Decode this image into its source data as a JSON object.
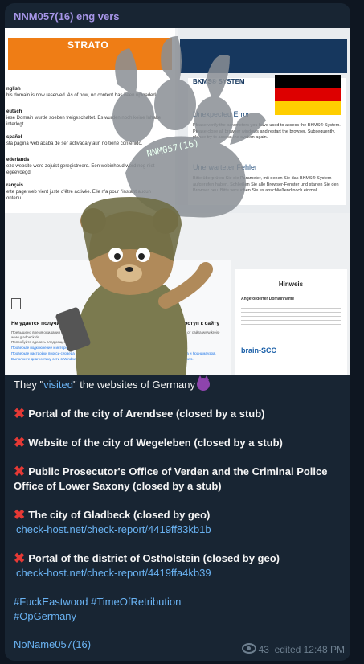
{
  "post": {
    "channel_name": "NNM057(16) eng vers",
    "media": {
      "strato": {
        "logo": "STRATO",
        "paragraphs": [
          {
            "lang": "nglish",
            "text": "his domain is now reserved. As of now, no content has been uploaded."
          },
          {
            "lang": "eutsch",
            "text": "iese Domain wurde soeben freigeschaltet. Es wurden noch keine Inhalte interlegt."
          },
          {
            "lang": "spañol",
            "text": "sta página web acaba de ser activada y aún no tiene contenido."
          },
          {
            "lang": "ederlands",
            "text": "eze website werd zojuist geregistreerd. Een webinhoud werd nog niet egeevoegd."
          },
          {
            "lang": "rançais",
            "text": "ette page web vient juste d'être activée. Elle n'a pour l'instant aucun ontenu."
          }
        ]
      },
      "bkms": {
        "logo": "BKMS® SYSTEM",
        "title_en": "Unexpected Error",
        "text_en": "Please verify the parameters you have used to access the BKMS® System. Please close all browser windows and restart the browser. Subsequently, please try to access the system again.",
        "title_de": "Unerwarteter Fehler",
        "text_de": "Bitte überprüfen Sie die Parameter, mit denen Sie das BKMS® System aufgerufen haben. Schließen Sie alle Browser-Fenster und starten Sie den Browser neu. Bitte versuchen Sie es anschließend noch einmal."
      },
      "watermark": "NNM057(16)",
      "lower_left": {
        "title": "Не удается получить доступ к сайту",
        "sub": "Превышено время ожидания ответа от сайта www.gladbeck.de.",
        "tips": [
          "Попробуйте сделать следующее:",
          "Проверьте подключение к интернету.",
          "Проверьте настройки прокси-сервера и брандмауэра.",
          "Выполните диагностику сети в Windows."
        ]
      },
      "lower_mid": {
        "title": "Не удается получить доступ к сайту",
        "sub": "Превышено время ожидания ответа от сайта www.kreis-oh.de.",
        "tips": [
          "Попробуйте сделать следующее:",
          "Проверьте подключение к интернету.",
          "Проверьте настройки прокси-сервера и брандмауэра.",
          "Выполните диагностику сети в Windows."
        ]
      },
      "hinweis": {
        "title": "Hinweis",
        "sub": "Angeforderter Domainname",
        "brand": "brain-SCC"
      }
    },
    "intro_prefix": "They \"",
    "intro_link": "visited",
    "intro_suffix": "\" the websites of Germany",
    "items": [
      {
        "text": "Portal of the city of Arendsee (closed by a stub)",
        "link": ""
      },
      {
        "text": "Website of the city of Wegeleben (closed by a stub)",
        "link": ""
      },
      {
        "text": "Public Prosecutor's Office of Verden and the Criminal Police Office of Lower Saxony (closed by a stub)",
        "link": ""
      },
      {
        "text": "The city of Gladbeck (closed by geo)",
        "link": "check-host.net/check-report/4419ff83kb1b"
      },
      {
        "text": "Portal of the district of Ostholstein (closed by geo)",
        "link": "check-host.net/check-report/4419ffa4kb39"
      }
    ],
    "hashtags_line1": "#FuckEastwood #TimeOfRetribution",
    "hashtags_line2": "#OpGermany",
    "signature": "NoName057(16)",
    "views": "43",
    "edited_time": "edited 12:48 PM"
  },
  "colors": {
    "background": "#0e1621",
    "bubble": "#182533",
    "channel_name": "#a695e7",
    "link": "#6ab3f3",
    "cross": "#e53935",
    "strato_orange": "#ef7d15"
  },
  "icons": [
    "cross-mark-icon",
    "smiling-devil-icon",
    "eye-icon",
    "paw-icon"
  ]
}
